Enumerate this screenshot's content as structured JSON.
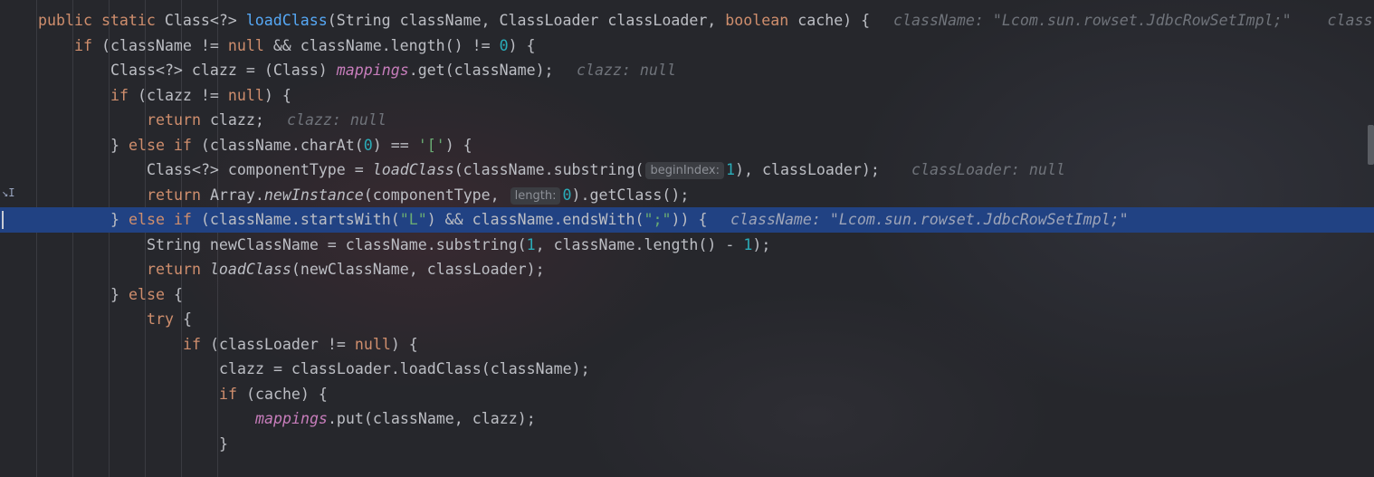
{
  "editor": {
    "lines": [
      {
        "indent": 0,
        "tokens": [
          [
            "kw",
            "public "
          ],
          [
            "kw",
            "static "
          ],
          [
            "",
            "Class<?> "
          ],
          [
            "fn",
            "loadClass"
          ],
          [
            "",
            "(String className, ClassLoader classLoader, "
          ],
          [
            "kw",
            "boolean "
          ],
          [
            "",
            "cache) {"
          ]
        ],
        "hint": "className: \"Lcom.sun.rowset.JdbcRowSetImpl;\"    class"
      },
      {
        "indent": 1,
        "tokens": [
          [
            "kw",
            "if "
          ],
          [
            "",
            "(className != "
          ],
          [
            "kw",
            "null "
          ],
          [
            "",
            "&& className.length() != "
          ],
          [
            "num",
            "0"
          ],
          [
            "",
            ") {"
          ]
        ]
      },
      {
        "indent": 2,
        "tokens": [
          [
            "",
            "Class<?> clazz = (Class) "
          ],
          [
            "static-field",
            "mappings"
          ],
          [
            "",
            ".get(className);"
          ]
        ],
        "hint": "clazz: null"
      },
      {
        "indent": 2,
        "tokens": [
          [
            "kw",
            "if "
          ],
          [
            "",
            "(clazz != "
          ],
          [
            "kw",
            "null"
          ],
          [
            "",
            ") {"
          ]
        ]
      },
      {
        "indent": 3,
        "tokens": [
          [
            "kw",
            "return "
          ],
          [
            "",
            "clazz;"
          ]
        ],
        "hint": "clazz: null"
      },
      {
        "indent": 2,
        "tokens": [
          [
            "",
            "} "
          ],
          [
            "kw",
            "else if "
          ],
          [
            "",
            "(className.charAt("
          ],
          [
            "num",
            "0"
          ],
          [
            "",
            ") == "
          ],
          [
            "str",
            "'['"
          ],
          [
            "",
            ") {"
          ]
        ]
      },
      {
        "indent": 3,
        "tokens": [
          [
            "",
            "Class<?> componentType = "
          ],
          [
            "static-call",
            "loadClass"
          ],
          [
            "",
            "(className.substring("
          ],
          [
            "param",
            "beginIndex:"
          ],
          [
            "num",
            "1"
          ],
          [
            "",
            "), classLoader);"
          ]
        ],
        "hint": "classLoader: null"
      },
      {
        "indent": 3,
        "tokens": [
          [
            "kw",
            "return "
          ],
          [
            "",
            "Array."
          ],
          [
            "static-call",
            "newInstance"
          ],
          [
            "",
            "(componentType, "
          ],
          [
            "param",
            "length:"
          ],
          [
            "num",
            "0"
          ],
          [
            "",
            ").getClass();"
          ]
        ]
      },
      {
        "indent": 2,
        "current": true,
        "tokens": [
          [
            "",
            "} "
          ],
          [
            "kw",
            "else if "
          ],
          [
            "",
            "(className.startsWith("
          ],
          [
            "str",
            "\"L\""
          ],
          [
            "",
            ") && className.endsWith("
          ],
          [
            "str",
            "\";\""
          ],
          [
            "",
            ")) {"
          ]
        ],
        "hint": "className: \"Lcom.sun.rowset.JdbcRowSetImpl;\""
      },
      {
        "indent": 3,
        "tokens": [
          [
            "",
            "String newClassName = className.substring("
          ],
          [
            "num",
            "1"
          ],
          [
            "",
            ", className.length() - "
          ],
          [
            "num",
            "1"
          ],
          [
            "",
            ");"
          ]
        ]
      },
      {
        "indent": 3,
        "tokens": [
          [
            "kw",
            "return "
          ],
          [
            "static-call",
            "loadClass"
          ],
          [
            "",
            "(newClassName, classLoader);"
          ]
        ]
      },
      {
        "indent": 2,
        "tokens": [
          [
            "",
            "} "
          ],
          [
            "kw",
            "else "
          ],
          [
            "",
            "{"
          ]
        ]
      },
      {
        "indent": 3,
        "tokens": [
          [
            "kw",
            "try "
          ],
          [
            "",
            "{"
          ]
        ]
      },
      {
        "indent": 4,
        "tokens": [
          [
            "kw",
            "if "
          ],
          [
            "",
            "(classLoader != "
          ],
          [
            "kw",
            "null"
          ],
          [
            "",
            ") {"
          ]
        ]
      },
      {
        "indent": 5,
        "tokens": [
          [
            "",
            "clazz = classLoader.loadClass(className);"
          ]
        ]
      },
      {
        "indent": 5,
        "tokens": [
          [
            "kw",
            "if "
          ],
          [
            "",
            "(cache) {"
          ]
        ]
      },
      {
        "indent": 6,
        "tokens": [
          [
            "static-field",
            "mappings"
          ],
          [
            "",
            ".put(className, clazz);"
          ]
        ]
      },
      {
        "indent": 5,
        "tokens": [
          [
            "",
            "}"
          ]
        ]
      },
      {
        "indent": 4,
        "tokens": [
          [
            "",
            ""
          ]
        ]
      }
    ]
  },
  "colors": {
    "background": "#26272c",
    "current_line": "#214283",
    "keyword": "#cf8e6d",
    "function": "#56a8f5",
    "number": "#2aacb8",
    "string": "#6aab73",
    "static_field": "#c77dbb",
    "text": "#bcbec4",
    "inlay_hint": "#6f737a"
  }
}
